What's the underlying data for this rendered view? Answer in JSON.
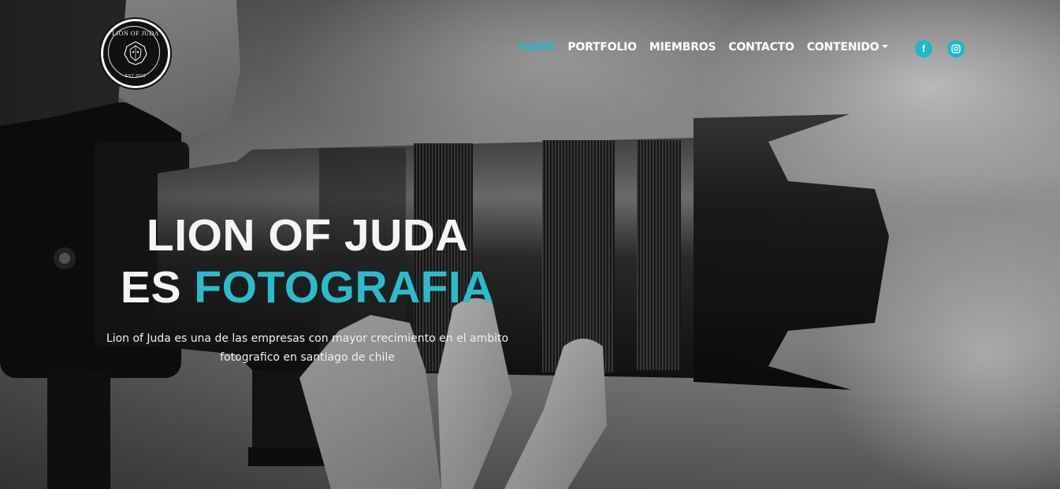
{
  "logo": {
    "top_text": "LION OF JUDA",
    "bottom_text": "EST 2019",
    "icon": "lion-head-icon"
  },
  "nav": {
    "items": [
      {
        "label": "HOME",
        "active": true
      },
      {
        "label": "PORTFOLIO",
        "active": false
      },
      {
        "label": "MIEMBROS",
        "active": false
      },
      {
        "label": "CONTACTO",
        "active": false
      },
      {
        "label": "CONTENIDO",
        "active": false,
        "dropdown": true
      }
    ]
  },
  "social": {
    "facebook": {
      "icon": "facebook-icon",
      "glyph": "f"
    },
    "instagram": {
      "icon": "instagram-icon"
    }
  },
  "hero": {
    "line1": "LION OF JUDA",
    "line2_prefix": "ES ",
    "line2_accent": "FOTOGRAFIA",
    "subtitle": "Lion of Juda es una de las empresas con mayor crecimiento en el ambito fotografico en santiago de chile"
  },
  "colors": {
    "accent": "#29b6c9",
    "text": "#ffffff"
  }
}
